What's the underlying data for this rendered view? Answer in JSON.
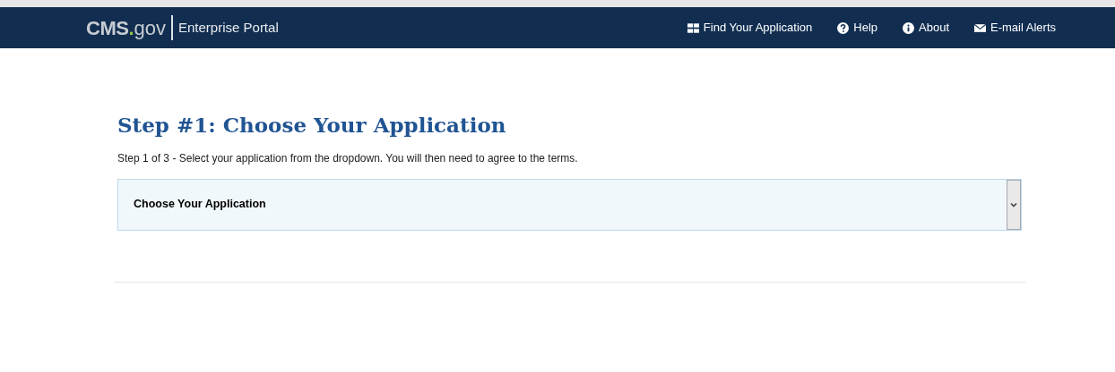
{
  "header": {
    "logo": {
      "brand": "CMS",
      "dot": ".",
      "suffix": "gov",
      "product": "Enterprise Portal"
    },
    "nav": [
      {
        "kind": "grid",
        "label": "Find Your Application"
      },
      {
        "kind": "question",
        "label": "Help"
      },
      {
        "kind": "info",
        "label": "About"
      },
      {
        "kind": "envelope",
        "label": "E-mail Alerts"
      }
    ]
  },
  "main": {
    "title": "Step #1: Choose Your Application",
    "instructions": "Step 1 of 3 - Select your application from the dropdown. You will then need to agree to the terms.",
    "dropdown": {
      "value": "Choose Your Application"
    }
  }
}
